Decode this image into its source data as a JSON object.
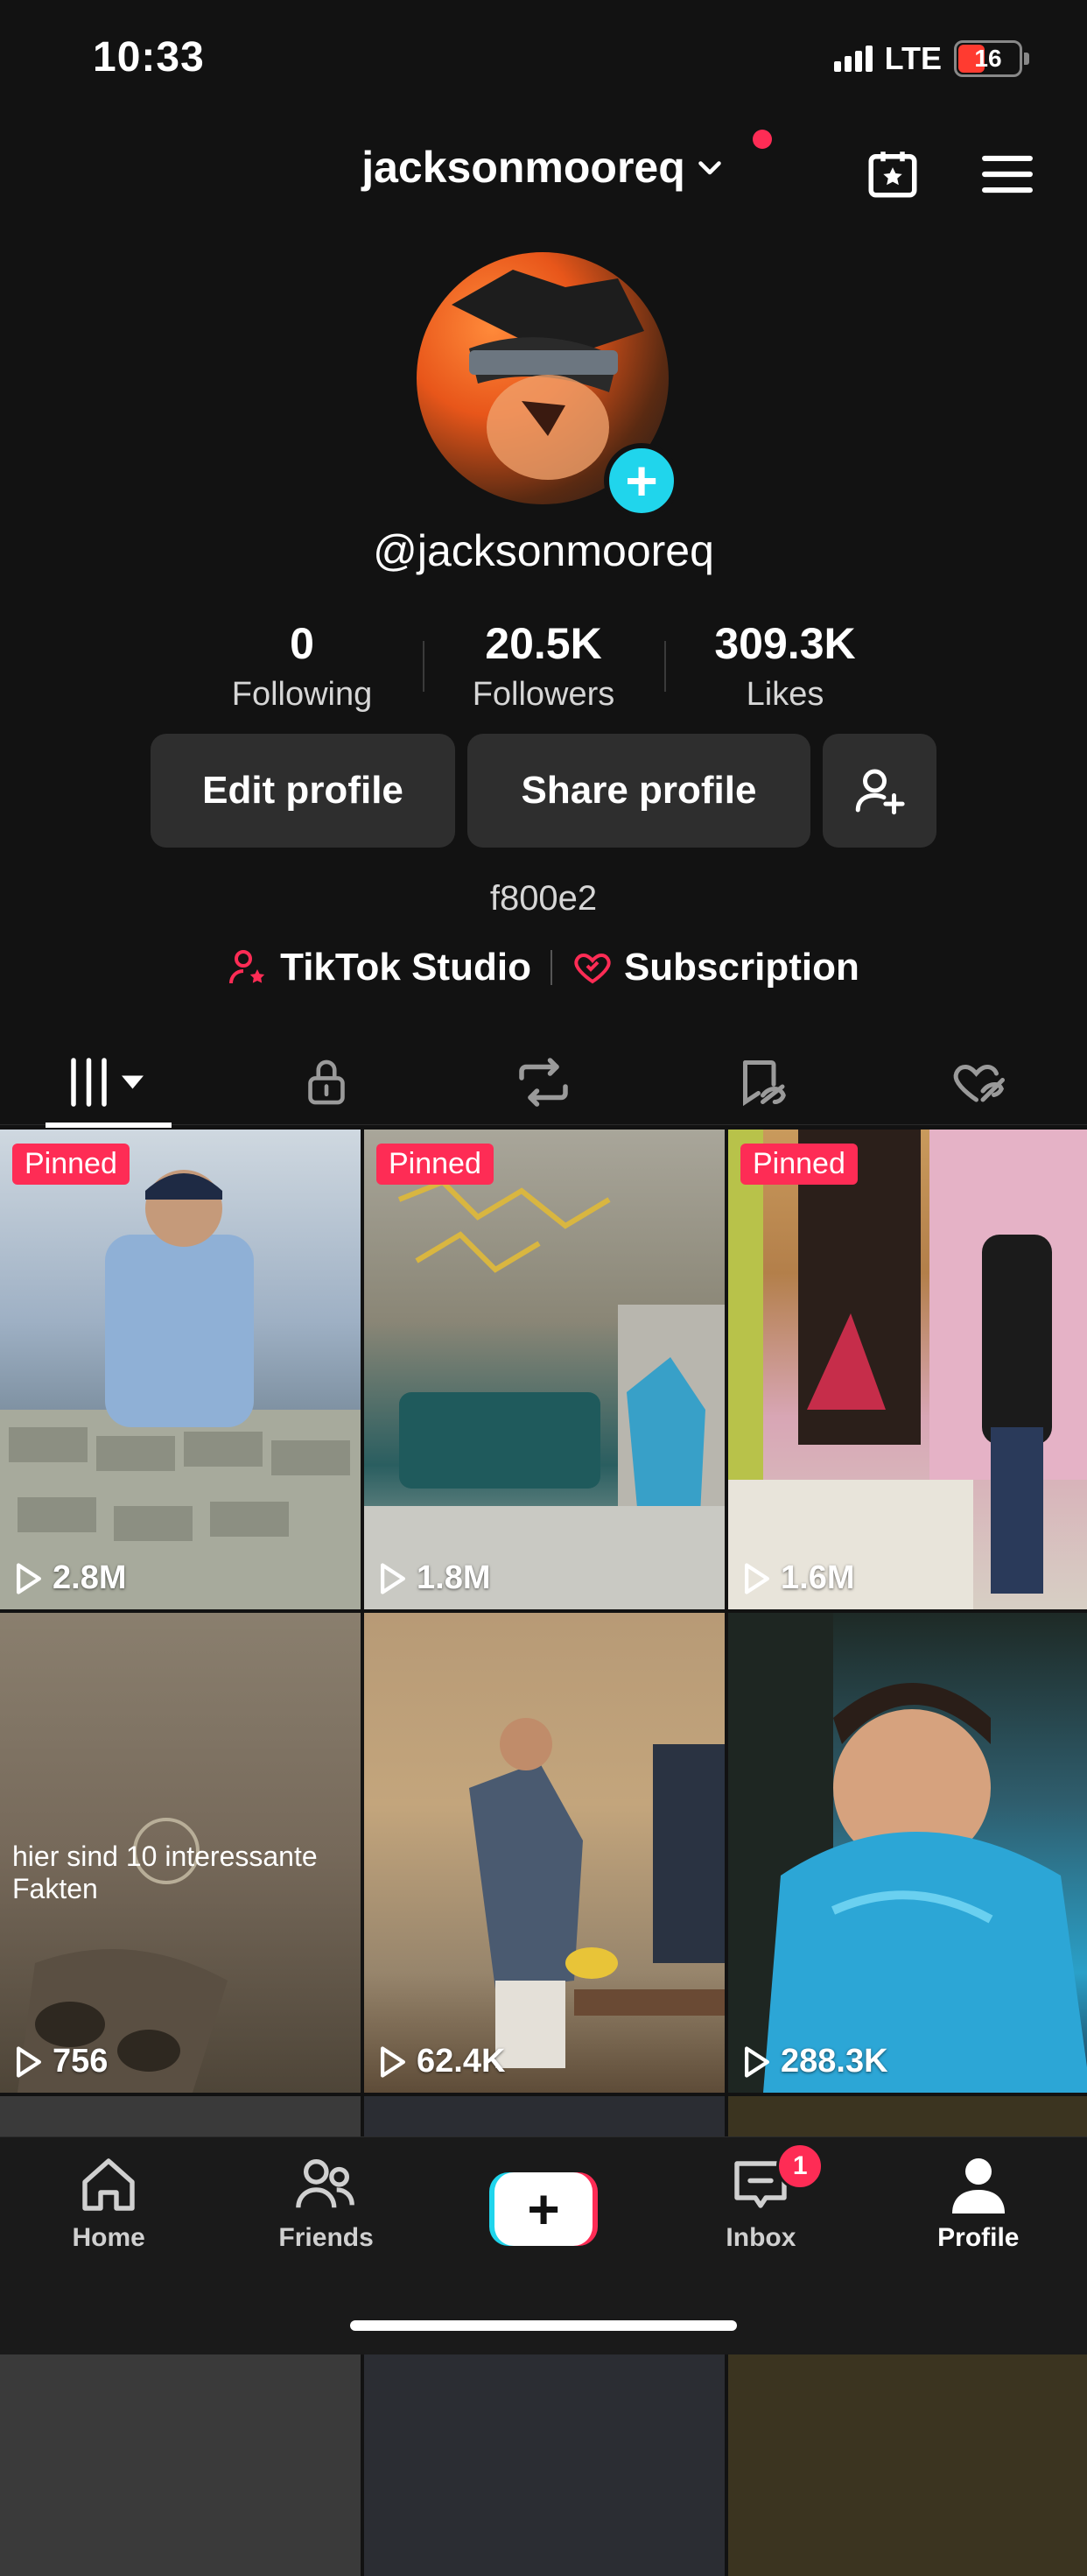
{
  "status_bar": {
    "time": "10:33",
    "network": "LTE",
    "battery": "16"
  },
  "header": {
    "username": "jacksonmooreq"
  },
  "profile": {
    "handle": "@jacksonmooreq",
    "stats": [
      {
        "value": "0",
        "label": "Following"
      },
      {
        "value": "20.5K",
        "label": "Followers"
      },
      {
        "value": "309.3K",
        "label": "Likes"
      }
    ],
    "edit_label": "Edit profile",
    "share_label": "Share profile",
    "bio": "f800e2",
    "studio_label": "TikTok Studio",
    "subscription_label": "Subscription"
  },
  "videos": [
    {
      "pinned": "Pinned",
      "views": "2.8M"
    },
    {
      "pinned": "Pinned",
      "views": "1.8M"
    },
    {
      "pinned": "Pinned",
      "views": "1.6M"
    },
    {
      "views": "756",
      "overlay_text": "hier sind 10 interessante Fakten"
    },
    {
      "views": "62.4K"
    },
    {
      "views": "288.3K"
    }
  ],
  "nav": {
    "home": "Home",
    "friends": "Friends",
    "inbox": "Inbox",
    "inbox_badge": "1",
    "profile": "Profile"
  },
  "colors": {
    "accent": "#fe2c55",
    "cyan": "#20d5ec",
    "background": "#121212"
  }
}
